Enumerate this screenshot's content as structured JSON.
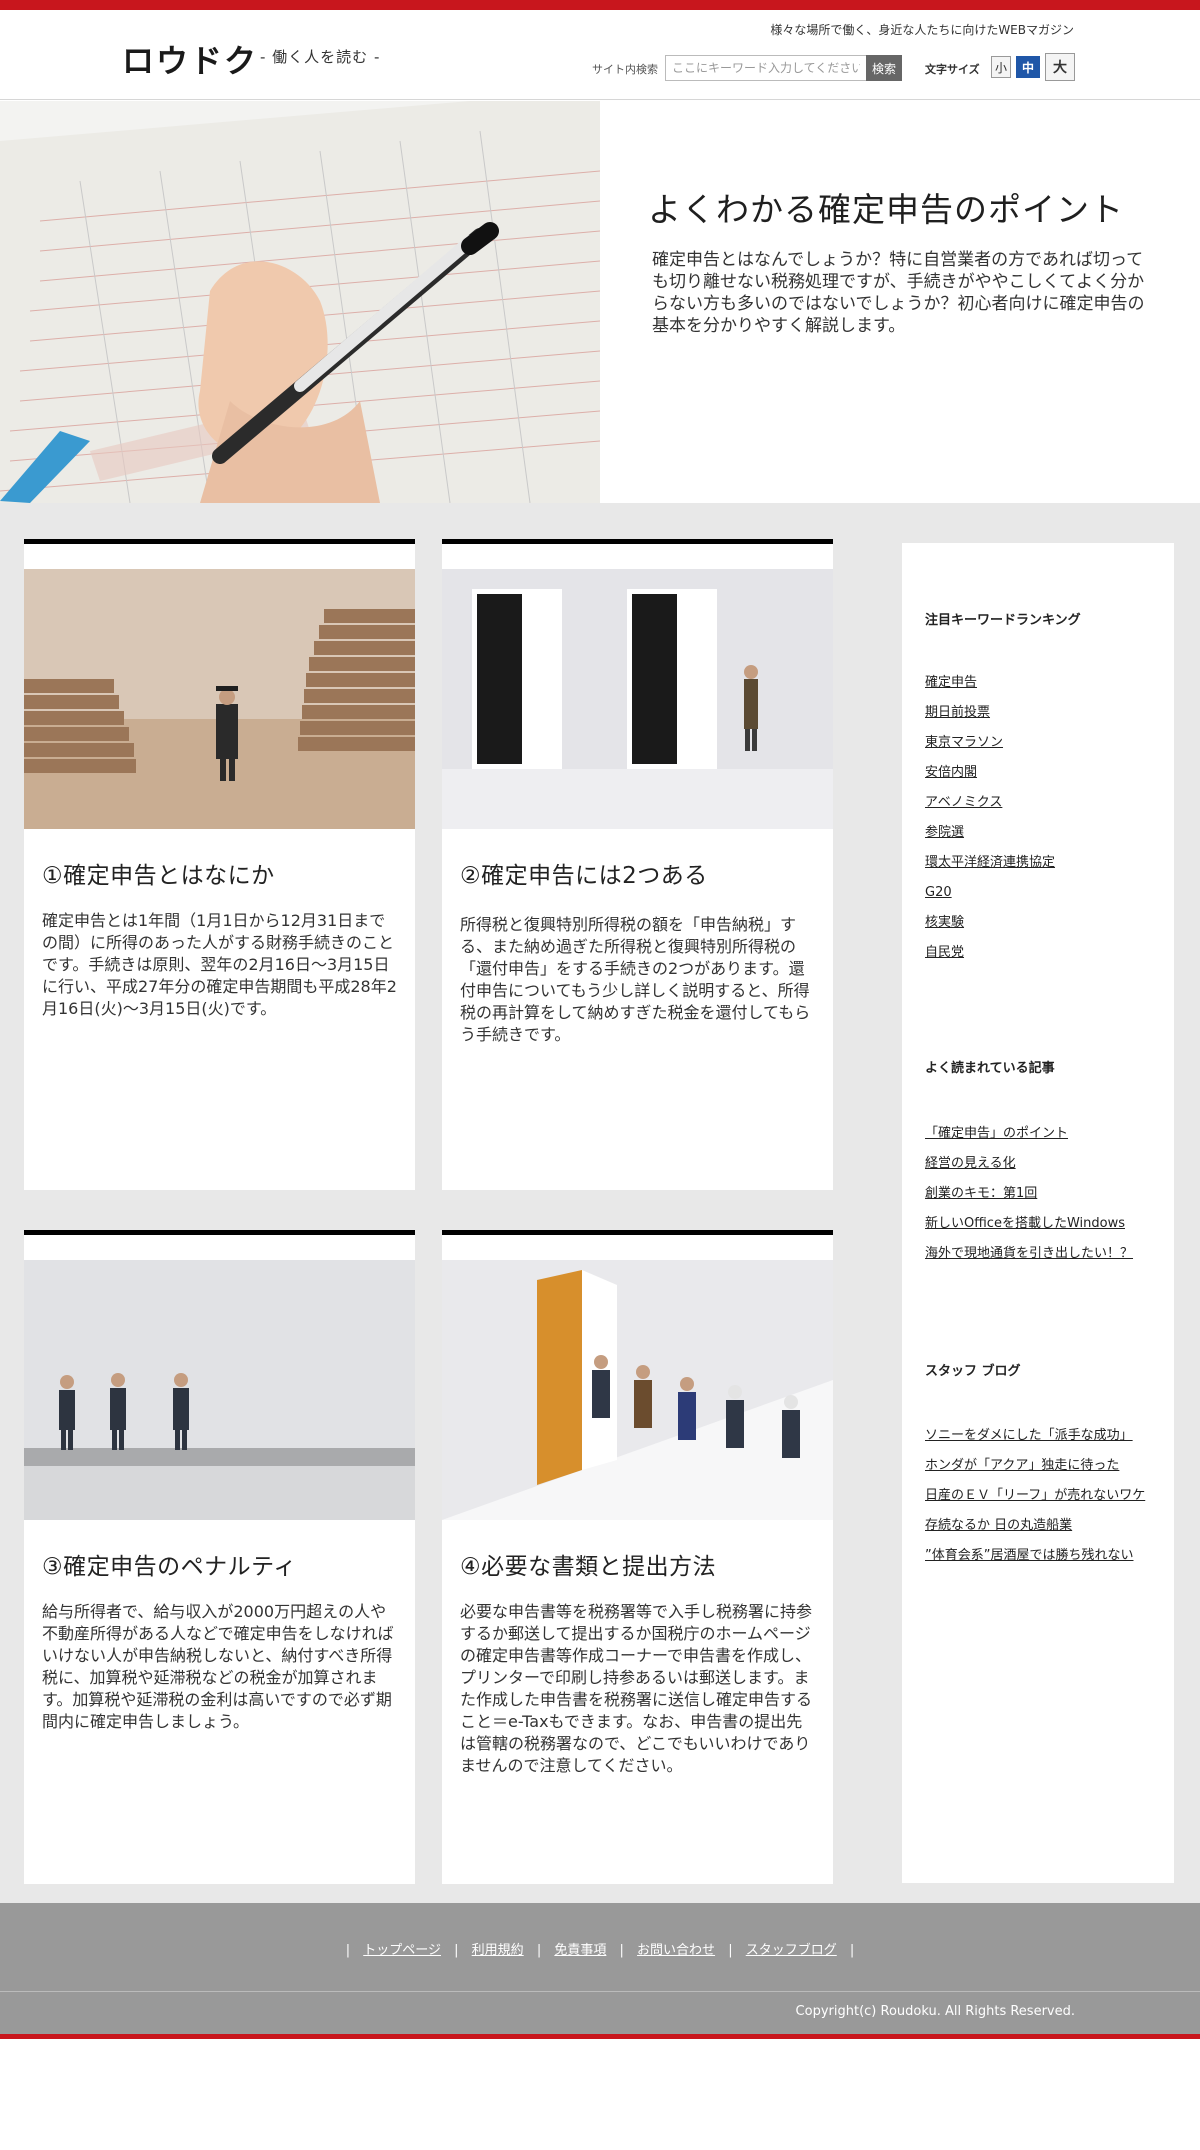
{
  "site": {
    "logo": "ロウドク",
    "logo_sub": "- 働く人を読む -",
    "tagline": "様々な場所で働く、身近な人たちに向けたWEBマガジン",
    "search_label": "サイト内検索",
    "search_placeholder": "ここにキーワード入力してください",
    "search_button": "検索",
    "font_size_label": "文字サイズ",
    "font_small": "小",
    "font_medium": "中",
    "font_large": "大"
  },
  "hero": {
    "title": "よくわかる確定申告のポイント",
    "text": "確定申告とはなんでしょうか？特に自営業者の方であれば切っても切り離せない税務処理ですが、手続きがややこしくてよく分からない方も多いのではないでしょうか？初心者向けに確定申告の基本を分かりやすく解説します。"
  },
  "cards": [
    {
      "title": "①確定申告とはなにか",
      "text": "確定申告とは1年間（1月1日から12月31日までの間）に所得のあった人がする財務手続きのことです。手続きは原則、翌年の2月16日～3月15日に行い、平成27年分の確定申告期間も平成28年2月16日(火)～3月15日(火)です。"
    },
    {
      "title": "②確定申告には2つある",
      "text": "所得税と復興特別所得税の額を「申告納税」する、また納め過ぎた所得税と復興特別所得税の「還付申告」をする手続きの2つがあります。還付申告についてもう少し詳しく説明すると、所得税の再計算をして納めすぎた税金を還付してもらう手続きです。"
    },
    {
      "title": "③確定申告のペナルティ",
      "text": "給与所得者で、給与収入が2000万円超えの人や不動産所得がある人などで確定申告をしなければいけない人が申告納税しないと、納付すべき所得税に、加算税や延滞税などの税金が加算されます。加算税や延滞税の金利は高いですので必ず期間内に確定申告しましょう。"
    },
    {
      "title": "④必要な書類と提出方法",
      "text": "必要な申告書等を税務署等で入手し税務署に持参するか郵送して提出するか国税庁のホームページの確定申告書等作成コーナーで申告書を作成し、プリンターで印刷し持参あるいは郵送します。また作成した申告書を税務署に送信し確定申告すること＝e-Taxもできます。なお、申告書の提出先は管轄の税務署なので、どこでもいいわけでありませんので注意してください。"
    }
  ],
  "sidebar": {
    "ranking_heading": "注目キーワードランキング",
    "ranking": [
      "確定申告",
      "期日前投票",
      "東京マラソン",
      "安倍内閣",
      "アベノミクス",
      "参院選",
      "環太平洋経済連携協定",
      "G20",
      "核実験",
      "自民党"
    ],
    "popular_heading": "よく読まれている記事",
    "popular": [
      "「確定申告」のポイント",
      "経営の見える化",
      "創業のキモ：第1回",
      "新しいOfficeを搭載したWindows",
      "海外で現地通貨を引き出したい！？"
    ],
    "blog_heading": "スタッフ ブログ",
    "blog": [
      "ソニーをダメにした「派手な成功」",
      "ホンダが「アクア」独走に待った",
      "日産のＥＶ「リーフ」が売れないワケ",
      "存続なるか 日の丸造船業",
      "”体育会系”居酒屋では勝ち残れない"
    ]
  },
  "footer": {
    "links": [
      "トップページ",
      "利用規約",
      "免責事項",
      "お問い合わせ",
      "スタッフブログ"
    ],
    "copyright": "Copyright(c) Roudoku. All Rights Reserved."
  },
  "colors": {
    "accent_red": "#c8161d",
    "active_blue": "#1f57a8",
    "content_bg": "#e8e8e8",
    "footer_bg": "#999999"
  },
  "icons": [
    "search-icon"
  ]
}
